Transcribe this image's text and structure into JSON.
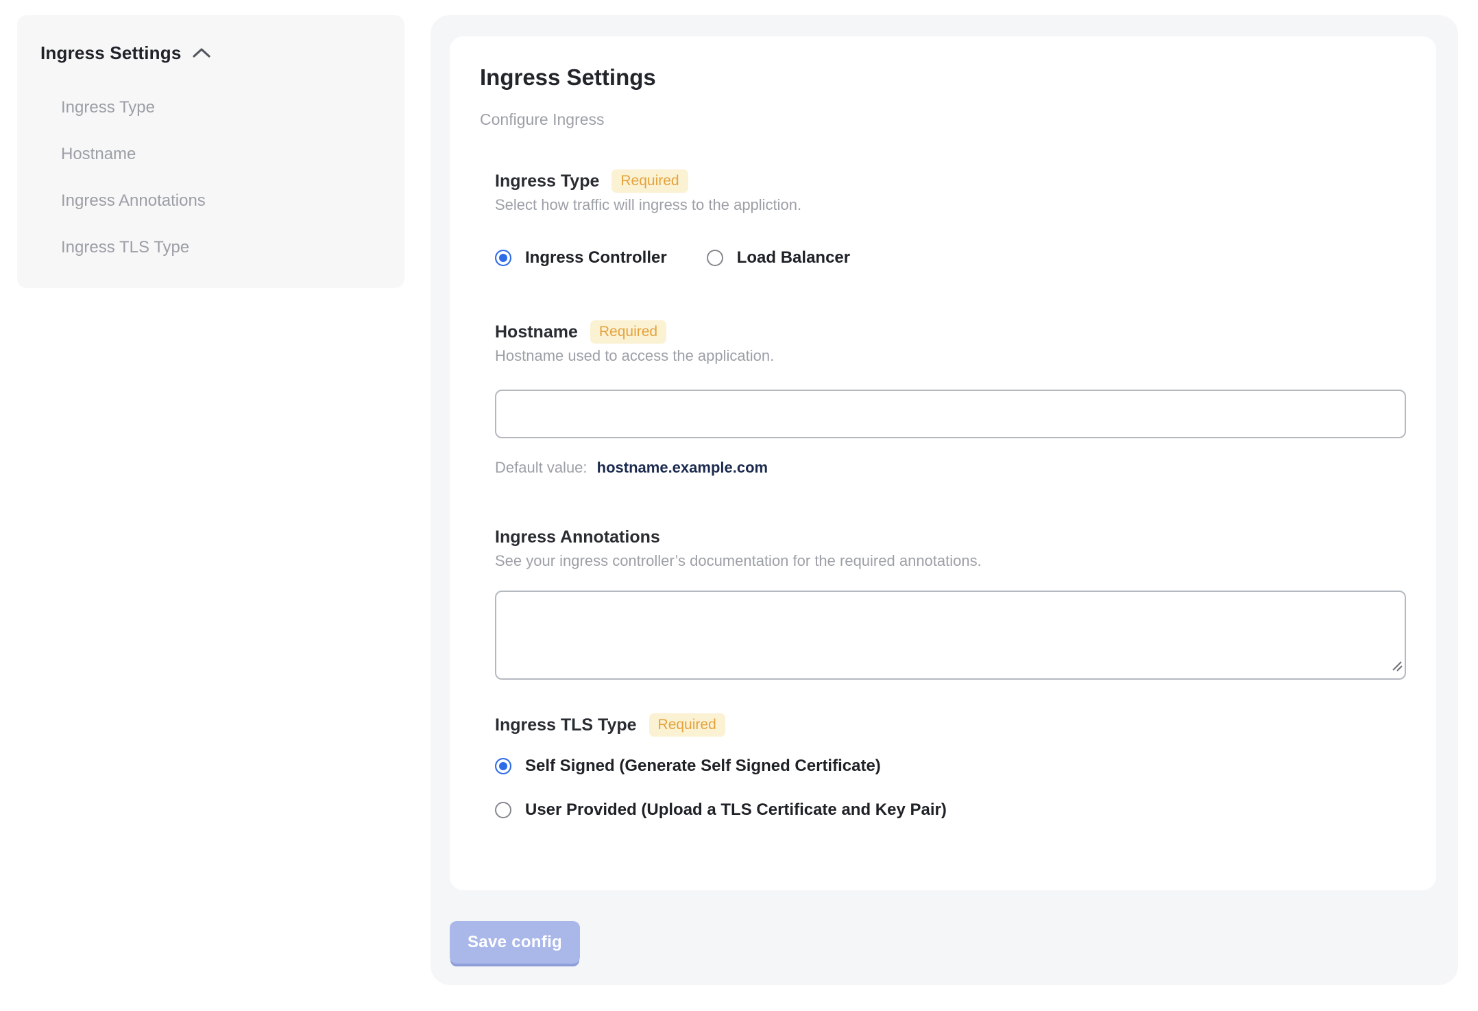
{
  "sidebar": {
    "title": "Ingress Settings",
    "collapse_icon": "chevron-up-icon",
    "items": [
      {
        "label": "Ingress Type"
      },
      {
        "label": "Hostname"
      },
      {
        "label": "Ingress Annotations"
      },
      {
        "label": "Ingress TLS Type"
      }
    ]
  },
  "main": {
    "title": "Ingress Settings",
    "subtitle": "Configure Ingress",
    "required_badge": "Required",
    "sections": {
      "ingress_type": {
        "label": "Ingress Type",
        "required": true,
        "description": "Select how traffic will ingress to the appliction.",
        "options": [
          {
            "label": "Ingress Controller",
            "selected": true
          },
          {
            "label": "Load Balancer",
            "selected": false
          }
        ]
      },
      "hostname": {
        "label": "Hostname",
        "required": true,
        "description": "Hostname used to access the application.",
        "value": "",
        "default_value_label": "Default value:",
        "default_value": "hostname.example.com"
      },
      "annotations": {
        "label": "Ingress Annotations",
        "description": "See your ingress controller’s documentation for the required annotations.",
        "value": ""
      },
      "tls": {
        "label": "Ingress TLS Type",
        "required": true,
        "options": [
          {
            "label": "Self Signed (Generate Self Signed Certificate)",
            "selected": true
          },
          {
            "label": "User Provided (Upload a TLS Certificate and Key Pair)",
            "selected": false
          }
        ]
      }
    },
    "save_button": "Save config"
  },
  "colors": {
    "accent_blue": "#2e6be8",
    "badge_bg": "#fbf1d3",
    "badge_text": "#e4a33d",
    "panel_bg": "#f5f6f8",
    "sidebar_bg": "#f7f7f8",
    "muted_text": "#9ca0a6",
    "dark_text": "#222529",
    "default_value_text": "#1b2a4e",
    "save_button_bg": "#a9b7e9",
    "save_button_edge": "#8d9ed9",
    "input_border": "#b4b9c0"
  }
}
